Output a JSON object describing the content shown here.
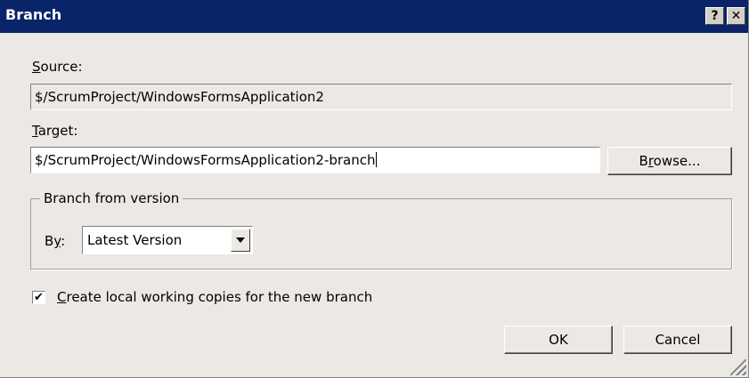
{
  "window": {
    "title": "Branch",
    "help_button": "?",
    "close_button": "✕"
  },
  "source": {
    "label_access": "S",
    "label_rest": "ource:",
    "value": "$/ScrumProject/WindowsFormsApplication2"
  },
  "target": {
    "label_access": "T",
    "label_rest": "arget:",
    "value": "$/ScrumProject/WindowsFormsApplication2-branch"
  },
  "browse_button": {
    "prefix": "B",
    "access": "r",
    "rest": "owse..."
  },
  "branch_from_version": {
    "legend": "Branch from version",
    "by_label_prefix": "B",
    "by_label_access": "y",
    "by_label_suffix": ":",
    "selected_option": "Latest Version"
  },
  "create_local_copies": {
    "checked": true,
    "check_glyph": "✔",
    "label_access": "C",
    "label_rest": "reate local working copies for the new branch"
  },
  "ok_button": "OK",
  "cancel_button": "Cancel"
}
